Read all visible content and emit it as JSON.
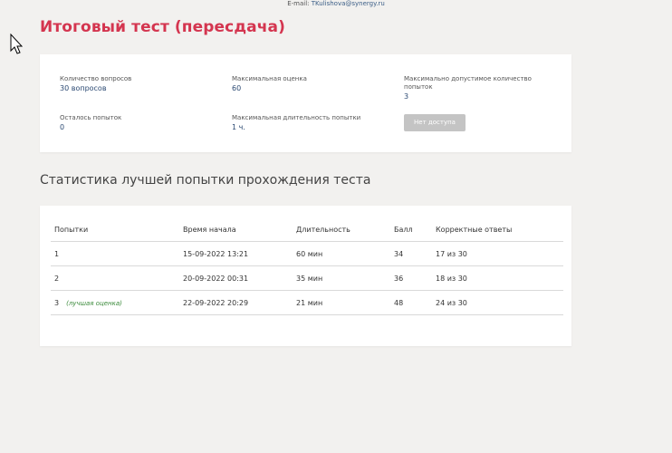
{
  "header": {
    "email_prefix": "E-mail:",
    "email": "TKulishova@synergy.ru"
  },
  "page": {
    "title": "Итоговый тест (пересдача)"
  },
  "info": {
    "questions_label": "Количество вопросов",
    "questions_value": "30 вопросов",
    "max_score_label": "Максимальная оценка",
    "max_score_value": "60",
    "max_attempts_label": "Максимально допустимое количество попыток",
    "max_attempts_value": "3",
    "attempts_left_label": "Осталось попыток",
    "attempts_left_value": "0",
    "max_duration_label": "Максимальная длительность попытки",
    "max_duration_value": "1 ч.",
    "no_access_button": "Нет доступа"
  },
  "stats": {
    "title": "Статистика лучшей попытки прохождения теста",
    "columns": [
      "Попытки",
      "Время начала",
      "Длительность",
      "Балл",
      "Корректные ответы"
    ],
    "best_label": "(лучшая оценка)",
    "rows": [
      {
        "attempt": "1",
        "start": "15-09-2022 13:21",
        "duration": "60 мин",
        "score": "34",
        "correct": "17 из 30"
      },
      {
        "attempt": "2",
        "start": "20-09-2022 00:31",
        "duration": "35 мин",
        "score": "36",
        "correct": "18 из 30"
      },
      {
        "attempt": "3",
        "start": "22-09-2022 20:29",
        "duration": "21 мин",
        "score": "48",
        "correct": "24 из 30"
      }
    ]
  },
  "colors": {
    "title_red": "#d4354f",
    "value_blue": "#2c4a73",
    "best_green": "#3a8a3a",
    "background": "#f2f1ef"
  }
}
